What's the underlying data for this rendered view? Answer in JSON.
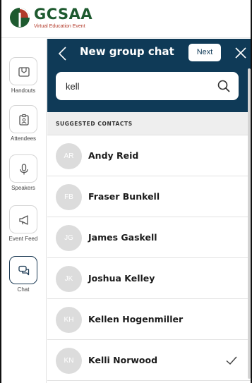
{
  "brand": {
    "title": "GCSAA",
    "subtitle": "Virtual Education Event",
    "green": "#1e5a2f",
    "red": "#b23a2a"
  },
  "rail": {
    "items": [
      {
        "label": "Handouts",
        "icon": "handout-icon"
      },
      {
        "label": "Attendees",
        "icon": "badge-icon"
      },
      {
        "label": "Speakers",
        "icon": "microphone-icon"
      },
      {
        "label": "Event Feed",
        "icon": "megaphone-icon"
      },
      {
        "label": "Chat",
        "icon": "chat-bubbles-icon",
        "active": true
      }
    ]
  },
  "panel": {
    "title": "New group chat",
    "next_label": "Next",
    "header_color": "#0f3a57",
    "search": {
      "value": "kell",
      "placeholder": ""
    },
    "section_label": "SUGGESTED CONTACTS",
    "contacts": [
      {
        "initials": "AR",
        "name": "Andy Reid",
        "selected": false
      },
      {
        "initials": "FB",
        "name": "Fraser Bunkell",
        "selected": false
      },
      {
        "initials": "JG",
        "name": "James Gaskell",
        "selected": false
      },
      {
        "initials": "JK",
        "name": "Joshua Kelley",
        "selected": false
      },
      {
        "initials": "KH",
        "name": "Kellen Hogenmiller",
        "selected": false
      },
      {
        "initials": "KN",
        "name": "Kelli Norwood",
        "selected": true
      }
    ]
  }
}
